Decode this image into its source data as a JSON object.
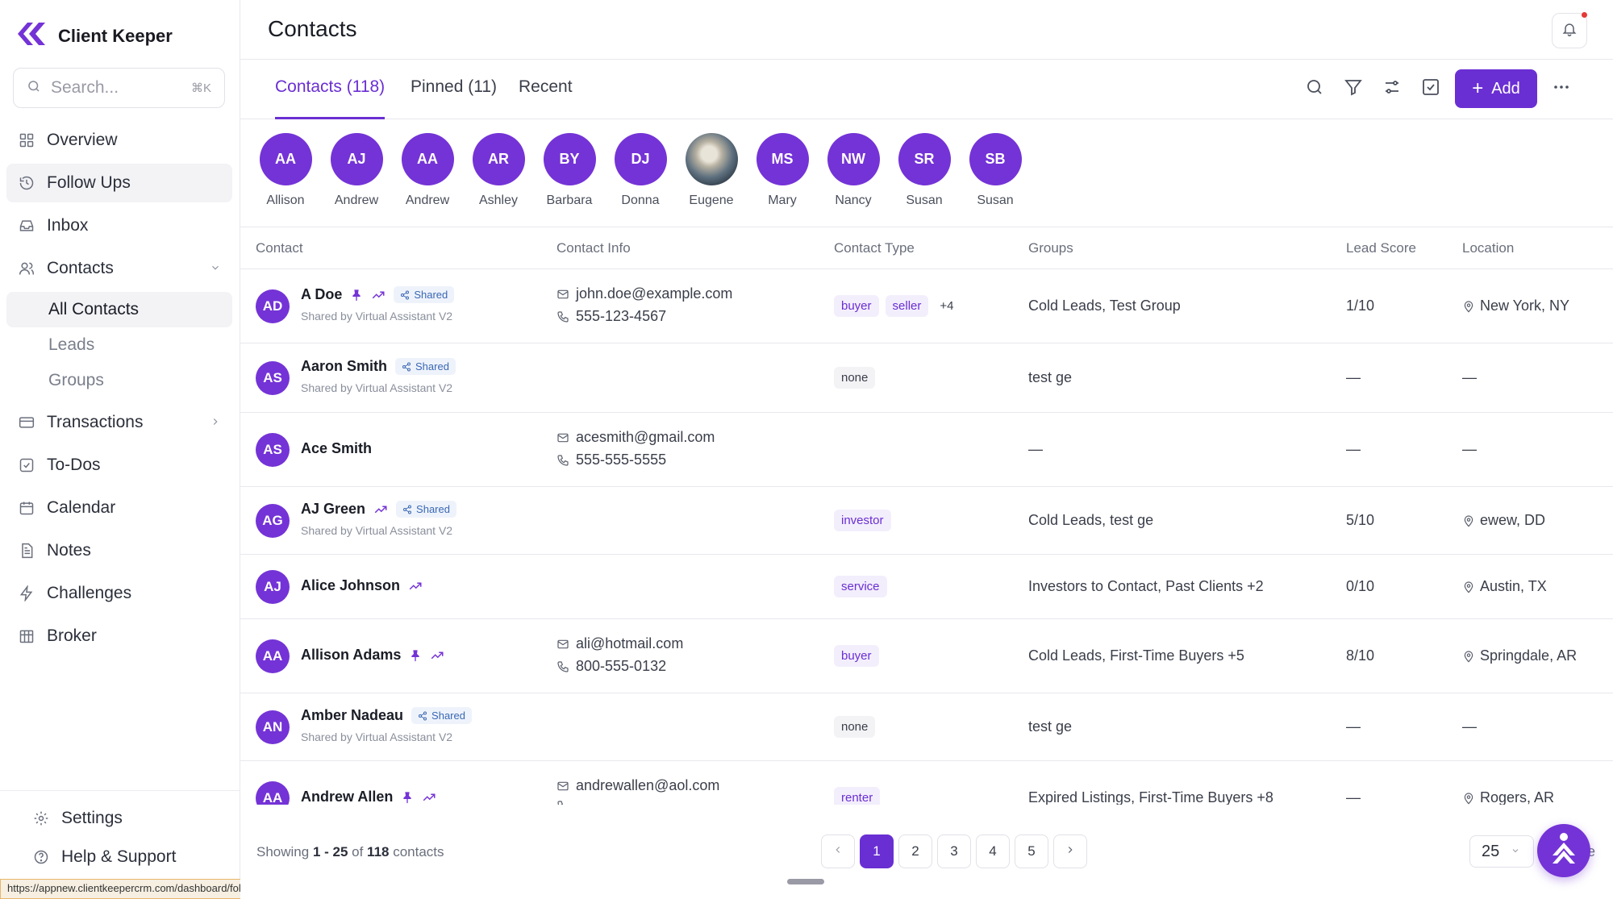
{
  "app": {
    "name": "Client Keeper"
  },
  "search": {
    "placeholder": "Search...",
    "shortcut": "⌘K"
  },
  "nav": {
    "overview": "Overview",
    "follow_ups": "Follow Ups",
    "inbox": "Inbox",
    "contacts": "Contacts",
    "contacts_sub": {
      "all": "All Contacts",
      "leads": "Leads",
      "groups": "Groups"
    },
    "transactions": "Transactions",
    "todos": "To-Dos",
    "calendar": "Calendar",
    "notes": "Notes",
    "challenges": "Challenges",
    "broker": "Broker"
  },
  "bottom_nav": {
    "settings": "Settings",
    "help": "Help & Support"
  },
  "status_url": "https://appnew.clientkeepercrm.com/dashboard/follow-ups",
  "header": {
    "title": "Contacts"
  },
  "tabs": [
    {
      "label": "Contacts (118)",
      "active": true
    },
    {
      "label": "Pinned (11)",
      "active": false
    },
    {
      "label": "Recent",
      "active": false
    }
  ],
  "toolbar": {
    "add_label": "Add"
  },
  "pinned": [
    {
      "initials": "AA",
      "name": "Allison"
    },
    {
      "initials": "AJ",
      "name": "Andrew"
    },
    {
      "initials": "AA",
      "name": "Andrew"
    },
    {
      "initials": "AR",
      "name": "Ashley"
    },
    {
      "initials": "BY",
      "name": "Barbara"
    },
    {
      "initials": "DJ",
      "name": "Donna"
    },
    {
      "initials": "",
      "name": "Eugene"
    },
    {
      "initials": "MS",
      "name": "Mary"
    },
    {
      "initials": "NW",
      "name": "Nancy"
    },
    {
      "initials": "SR",
      "name": "Susan"
    },
    {
      "initials": "SB",
      "name": "Susan"
    }
  ],
  "table": {
    "headers": {
      "contact": "Contact",
      "info": "Contact Info",
      "type": "Contact Type",
      "groups": "Groups",
      "lead": "Lead Score",
      "location": "Location"
    },
    "shared_label": "Shared",
    "shared_by": "Shared by Virtual Assistant V2",
    "rows": [
      {
        "initials": "AD",
        "name": "A Doe",
        "email": "john.doe@example.com",
        "phone": "555-123-4567",
        "types": [
          "buyer",
          "seller"
        ],
        "more": "+4",
        "groups": "Cold Leads, Test Group",
        "lead": "1/10",
        "location": "New York, NY"
      },
      {
        "initials": "AS",
        "name": "Aaron Smith",
        "type": "none",
        "groups": "test ge",
        "lead": "—",
        "location": "—"
      },
      {
        "initials": "AS",
        "name": "Ace Smith",
        "email": "acesmith@gmail.com",
        "phone": "555-555-5555",
        "groups": "—",
        "lead": "—",
        "location": "—"
      },
      {
        "initials": "AG",
        "name": "AJ Green",
        "type": "investor",
        "groups": "Cold Leads, test ge",
        "lead": "5/10",
        "location": "ewew, DD"
      },
      {
        "initials": "AJ",
        "name": "Alice Johnson",
        "type": "service",
        "groups": "Investors to Contact, Past Clients +2",
        "lead": "0/10",
        "location": "Austin, TX"
      },
      {
        "initials": "AA",
        "name": "Allison Adams",
        "email": "ali@hotmail.com",
        "phone": "800-555-0132",
        "type": "buyer",
        "groups": "Cold Leads, First-Time Buyers +5",
        "lead": "8/10",
        "location": "Springdale, AR"
      },
      {
        "initials": "AN",
        "name": "Amber Nadeau",
        "type": "none",
        "groups": "test ge",
        "lead": "—",
        "location": "—"
      },
      {
        "initials": "AA",
        "name": "Andrew Allen",
        "email": "andrewallen@aol.com",
        "type": "renter",
        "groups": "Expired Listings, First-Time Buyers +8",
        "lead": "—",
        "location": "Rogers, AR"
      }
    ]
  },
  "footer": {
    "showing_prefix": "Showing ",
    "range": "1 - 25",
    "of": " of ",
    "total": "118",
    "suffix": " contacts",
    "pages": [
      "1",
      "2",
      "3",
      "4",
      "5"
    ],
    "per_page": "25",
    "tail_text": "e"
  },
  "colors": {
    "accent": "#6a2fd3",
    "avatar": "#7433d6"
  }
}
